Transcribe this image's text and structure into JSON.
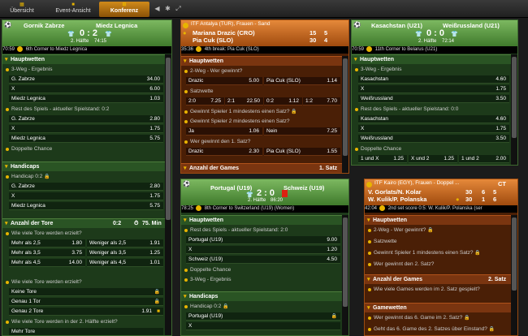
{
  "tabs": {
    "overview": "Übersicht",
    "event": "Event-Ansicht",
    "conference": "Konferenz"
  },
  "p1": {
    "home": "Gornik Zabrze",
    "away": "Miedz Legnica",
    "score": "0 : 2",
    "period": "2. Hälfte",
    "clock": "74:15",
    "time": "70:59",
    "info": "6th Corner to Miedz Legnica",
    "s1": "Hauptwetten",
    "m1": "3-Weg - Ergebnis",
    "o1": "G. Zabrze",
    "v1": "34.00",
    "o2": "X",
    "v2": "6.00",
    "o3": "Miedz Legnica",
    "v3": "1.03",
    "m2": "Rest des Spiels - aktueller Spielstand: 0:2",
    "o4": "G. Zabrze",
    "v4": "2.80",
    "o5": "X",
    "v5": "1.75",
    "o6": "Miedz Legnica",
    "v6": "5.75",
    "m3": "Doppelte Chance",
    "s2": "Handicaps",
    "m4": "Handicap 0:2",
    "o7": "G. Zabrze",
    "v7": "2.80",
    "o8": "X",
    "v8": "1.75",
    "o9": "Miedz Legnica",
    "v9": "5.75",
    "s3": "Anzahl der Tore",
    "s3r": "0:2",
    "s3t": "75. Min",
    "m5": "Wie viele Tore werden erzielt?",
    "g1": "Mehr als 2,5",
    "gv1": "1.80",
    "g2": "Weniger als 2,5",
    "gw2": "1.91",
    "g3": "Mehr als 3,5",
    "gv3": "3.75",
    "g4": "Weniger als 3,5",
    "gw4": "1.25",
    "g5": "Mehr als 4,5",
    "gv5": "14.00",
    "g6": "Weniger als 4,5",
    "gw6": "1.01",
    "m6": "Wie viele Tore werden erzielt?",
    "n1": "Keine Tore",
    "n2": "Genau 1 Tor",
    "n3": "Genau 2 Tore",
    "nv3": "1.91",
    "m7": "Wie viele Tore werden in der 2. Hälfte erzielt?",
    "n4": "Mehr Tore"
  },
  "p2": {
    "title": "ITF Antalya (TUR), Frauen - Sand",
    "home": "Mariana Drazic (CRO)",
    "away": "Pia Cuk (SLO)",
    "hs1": "15",
    "hs2": "5",
    "as1": "30",
    "as2": "4",
    "time": "35:36",
    "info": "4th break: Pia Cuk (SLO)",
    "s1": "Hauptwetten",
    "m1": "2-Weg - Wer gewinnt?",
    "o1": "Drazic",
    "v1": "5.00",
    "o2": "Pia Cuk (SLO)",
    "v2": "1.14",
    "m2": "Satzwette",
    "cs": [
      "2:0",
      "7.25",
      "2:1",
      "22.50",
      "0:2",
      "1.12",
      "1:2",
      "7.70"
    ],
    "m3": "Gewinnt Spieler 1 mindestens einen Satz?",
    "m4": "Gewinnt Spieler 2 mindestens einen Satz?",
    "o3": "Ja",
    "v3": "1.06",
    "o4": "Nein",
    "v4": "7.25",
    "m5": "Wer gewinnt den 1. Satz?",
    "o5": "Drazic",
    "v5": "2.30",
    "o6": "Pia Cuk (SLO)",
    "v6": "1.55",
    "s2": "Anzahl der Games",
    "s2r": "1. Satz"
  },
  "p3": {
    "home": "Kasachstan (U21)",
    "away": "Weißrussland (U21)",
    "score": "0 : 0",
    "period": "2. Hälfte",
    "clock": "72:14",
    "time": "70:59",
    "info": "11th Corner to Belarus (U21)",
    "s1": "Hauptwetten",
    "m1": "3-Weg - Ergebnis",
    "o1": "Kasachstan",
    "v1": "4.60",
    "o2": "X",
    "v2": "1.75",
    "o3": "Weißrussland",
    "v3": "3.50",
    "m2": "Rest des Spiels - aktueller Spielstand: 0:0",
    "o4": "Kasachstan",
    "v4": "4.60",
    "o5": "X",
    "v5": "1.75",
    "o6": "Weißrussland",
    "v6": "3.50",
    "m3": "Doppelte Chance",
    "d1": "1 und X",
    "dv1": "1.25",
    "d2": "X und 2",
    "dv2": "1.25",
    "d3": "1 und 2",
    "dv3": "2.00"
  },
  "p4": {
    "home": "Portugal (U19)",
    "away": "Schweiz (U19)",
    "score": "2 : 0",
    "period": "2. Hälfte",
    "clock": "86:20",
    "time": "78:25",
    "info": "8th Corner to Switzerland (U19) (Women)",
    "s1": "Hauptwetten",
    "m1": "Rest des Spiels - aktueller Spielstand: 2:0",
    "o1": "Portugal (U19)",
    "v1": "9.00",
    "o2": "X",
    "v2": "1.20",
    "o3": "Schweiz (U19)",
    "v3": "4.50",
    "m2": "Doppelte Chance",
    "m3": "3-Weg - Ergebnis",
    "s2": "Handicaps",
    "m4": "Handicap 0:2",
    "o4": "Portugal (U19)",
    "o5": "X"
  },
  "p5": {
    "title": "ITF Kairo (EGY), Frauen - Doppel ...",
    "home": "V. Gorlats/N. Kolar",
    "away": "W. Kulik/P. Polanska",
    "hs1": "30",
    "hs2": "6",
    "hs3": "5",
    "as1": "30",
    "as2": "1",
    "as3": "6",
    "tb": "CT",
    "time": "42:04",
    "info": "2nd set score 0:5: W. Kulik/P. Polanska (ser",
    "s1": "Hauptwetten",
    "m1": "2-Weg - Wer gewinnt?",
    "m2": "Satzwette",
    "m3": "Gewinnt Spieler 1 mindestens einen Satz?",
    "m4": "Wer gewinnt den 2. Satz?",
    "s2": "Anzahl der Games",
    "s2r": "2. Satz",
    "m5": "Wie viele Games werden im 2. Satz gespielt?",
    "s3": "Gamewetten",
    "m6": "Wer gewinnt das 6. Game im 2. Satz?",
    "m7": "Geht das 6. Game des 2. Satzes über Einstand?"
  },
  "colors": {
    "accent": "#e8b400",
    "green": "#3f7a2c",
    "orange": "#9f4a0e"
  }
}
